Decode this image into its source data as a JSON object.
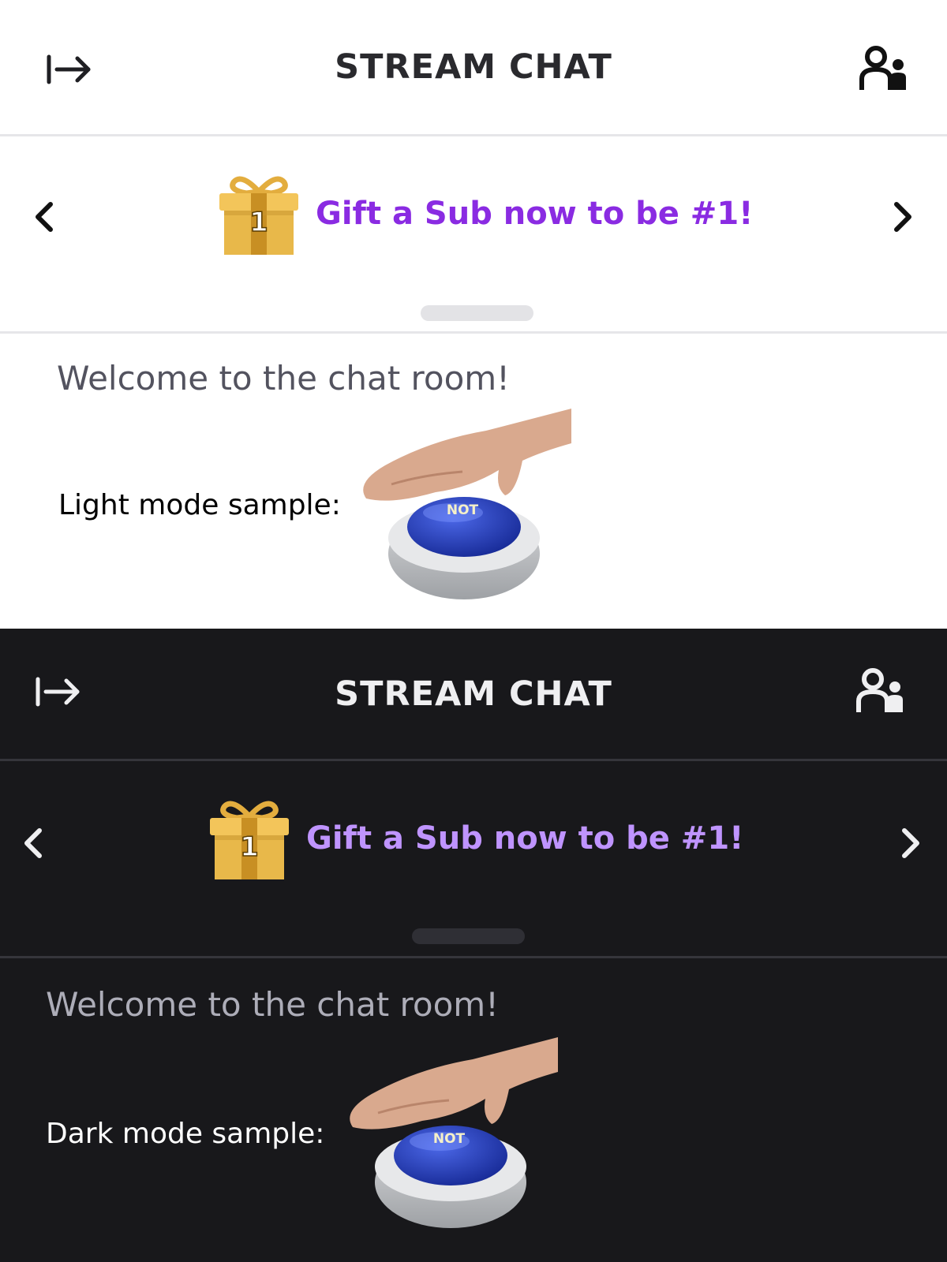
{
  "light": {
    "header": {
      "title": "STREAM CHAT",
      "collapse_icon": "collapse-right-icon",
      "users_icon": "users-icon"
    },
    "banner": {
      "prev_icon": "chevron-left-icon",
      "next_icon": "chevron-right-icon",
      "gift_icon": "gift-icon",
      "gift_badge": "1",
      "promo_text": "Gift a Sub now to be #1!"
    },
    "chat": {
      "welcome": "Welcome to the chat room!",
      "sample_label": "Light mode sample:",
      "emote_text": "NOT"
    }
  },
  "dark": {
    "header": {
      "title": "STREAM CHAT",
      "collapse_icon": "collapse-right-icon",
      "users_icon": "users-icon"
    },
    "banner": {
      "prev_icon": "chevron-left-icon",
      "next_icon": "chevron-right-icon",
      "gift_icon": "gift-icon",
      "gift_badge": "1",
      "promo_text": "Gift a Sub now to be #1!"
    },
    "chat": {
      "welcome": "Welcome to the chat room!",
      "sample_label": "Dark mode sample:",
      "emote_text": "NOT"
    }
  },
  "colors": {
    "light_bg": "#ffffff",
    "dark_bg": "#18181b",
    "promo_light": "#8a2be2",
    "promo_dark": "#bf94ff",
    "gift_gold": "#e8b84a",
    "button_blue": "#2c45c9"
  }
}
